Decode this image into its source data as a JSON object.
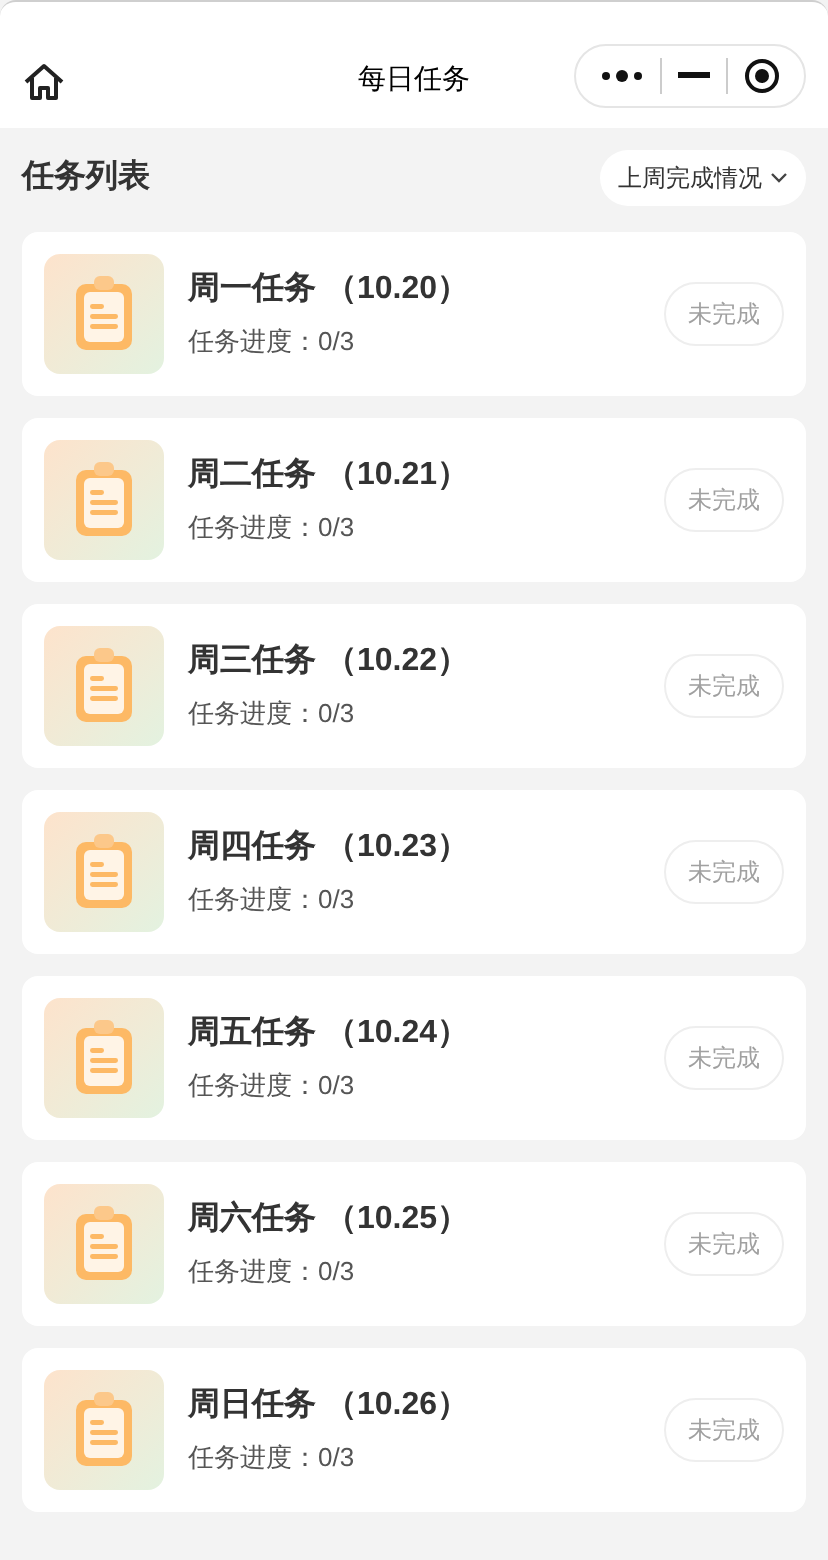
{
  "nav": {
    "title": "每日任务"
  },
  "section": {
    "title": "任务列表",
    "filter": "上周完成情况"
  },
  "tasks": [
    {
      "title": "周一任务 （10.20）",
      "progress": "任务进度：0/3",
      "status": "未完成",
      "completed": false
    },
    {
      "title": "周二任务 （10.21）",
      "progress": "任务进度：0/3",
      "status": "未完成",
      "completed": false
    },
    {
      "title": "周三任务 （10.22）",
      "progress": "任务进度：0/3",
      "status": "未完成",
      "completed": false
    },
    {
      "title": "周四任务 （10.23）",
      "progress": "任务进度：0/3",
      "status": "未完成",
      "completed": false
    },
    {
      "title": "周五任务 （10.24）",
      "progress": "任务进度：0/3",
      "status": "未完成",
      "completed": false
    },
    {
      "title": "周六任务 （10.25）",
      "progress": "任务进度：0/3",
      "status": "未完成",
      "completed": false
    },
    {
      "title": "周日任务 （10.26）",
      "progress": "任务进度：0/3",
      "status": "未完成",
      "completed": false
    }
  ]
}
